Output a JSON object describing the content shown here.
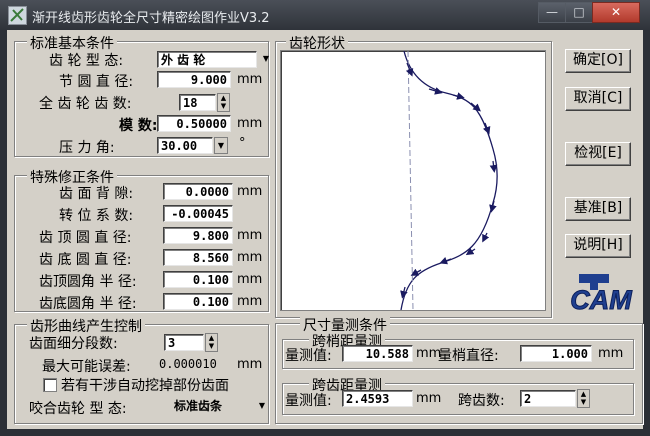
{
  "window": {
    "title": "渐开线齿形齿轮全尺寸精密绘图作业V3.2",
    "minimize": "—",
    "maximize": "□",
    "close": "✕"
  },
  "std": {
    "legend": "标准基本条件",
    "type_label": "齿 轮 型 态:",
    "type_value": "外 齿 轮",
    "pitch_label": "节 圆 直 径:",
    "pitch_value": "9.000",
    "pitch_unit": "mm",
    "teeth_label": "全 齿 轮 齿 数:",
    "teeth_value": "18",
    "module_label": "模 数:",
    "module_value": "0.50000",
    "module_unit": "mm",
    "pa_label": "压 力 角:",
    "pa_value": "30.00",
    "pa_unit": "°"
  },
  "corr": {
    "legend": "特殊修正条件",
    "backlash_label": "齿 面 背 隙:",
    "backlash_value": "0.0000",
    "backlash_unit": "mm",
    "shift_label": "转 位 系 数:",
    "shift_value": "-0.00045",
    "tip_label": "齿 顶 圆 直 径:",
    "tip_value": "9.800",
    "tip_unit": "mm",
    "root_label": "齿 底 圆 直 径:",
    "root_value": "8.560",
    "root_unit": "mm",
    "tipr_label": "齿顶圆角 半 径:",
    "tipr_value": "0.100",
    "tipr_unit": "mm",
    "rootr_label": "齿底圆角 半 径:",
    "rootr_value": "0.100",
    "rootr_unit": "mm"
  },
  "curve": {
    "legend": "齿形曲线产生控制",
    "seg_label": "齿面细分段数:",
    "seg_value": "3",
    "err_label": "最大可能误差:",
    "err_value": "0.000010",
    "err_unit": "mm",
    "check_label": "若有干涉自动挖掉部份齿面",
    "mate_label": "咬合齿轮 型 态:",
    "mate_value": "标准齿条"
  },
  "shape": {
    "legend": "齿轮形状"
  },
  "measure": {
    "legend": "尺寸量测条件",
    "pin_legend": "跨梢距量测",
    "pin_value_label": "量测值:",
    "pin_value": "10.588",
    "pin_value_unit": "mm",
    "pin_dia_label": "量梢直径:",
    "pin_dia_value": "1.000",
    "pin_dia_unit": "mm",
    "span_legend": "跨齿距量测",
    "span_value_label": "量测值:",
    "span_value": "2.4593",
    "span_value_unit": "mm",
    "span_teeth_label": "跨齿数:",
    "span_teeth_value": "2"
  },
  "buttons": {
    "ok": "确定[O]",
    "cancel": "取消[C]",
    "view": "检视[E]",
    "base": "基准[B]",
    "help": "说明[H]"
  },
  "logo": {
    "text": "CAM"
  },
  "icons": {
    "dropdown": "chevron-down-icon",
    "spin": "spin-updown-icon",
    "app": "app-icon",
    "logo": "cam-logo-icon"
  }
}
